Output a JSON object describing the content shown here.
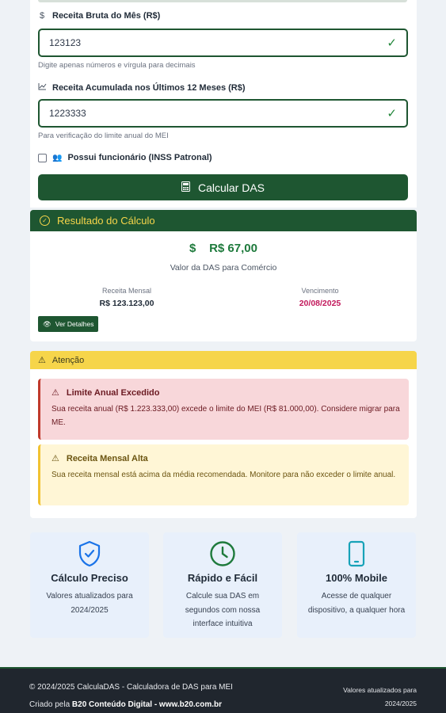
{
  "form": {
    "revenue_label": "Receita Bruta do Mês (R$)",
    "revenue_value": "123123",
    "revenue_hint": "Digite apenas números e vírgula para decimais",
    "accumulated_label": "Receita Acumulada nos Últimos 12 Meses (R$)",
    "accumulated_value": "1223333",
    "accumulated_hint": "Para verificação do limite anual do MEI",
    "employee_label": "Possui funcionário (INSS Patronal)",
    "employee_checked": false,
    "calculate_label": "Calcular DAS",
    "icons": {
      "revenue": "dollar-icon",
      "accumulated": "chart-line-icon",
      "employee": "people-icon",
      "calculate": "calculator-icon",
      "valid": "check-icon"
    }
  },
  "result": {
    "header": "Resultado do Cálculo",
    "currency_symbol": "$",
    "amount": "R$ 67,00",
    "amount_label": "Valor da DAS para Comércio",
    "monthly_label": "Receita Mensal",
    "monthly_value": "R$ 123.123,00",
    "due_label": "Vencimento",
    "due_value": "20/08/2025",
    "details_button": "Ver Detalhes"
  },
  "attention": {
    "header": "Atenção",
    "alerts": [
      {
        "type": "danger",
        "title": "Limite Anual Excedido",
        "body": "Sua receita anual (R$ 1.223.333,00) excede o limite do MEI (R$ 81.000,00). Considere migrar para ME."
      },
      {
        "type": "warning",
        "title": "Receita Mensal Alta",
        "body": "Sua receita mensal está acima da média recomendada. Monitore para não exceder o limite anual."
      }
    ]
  },
  "features": [
    {
      "icon": "shield-check-icon",
      "title": "Cálculo Preciso",
      "description": "Valores atualizados para 2024/2025"
    },
    {
      "icon": "clock-icon",
      "title": "Rápido e Fácil",
      "description": "Calcule sua DAS em segundos com nossa interface intuitiva"
    },
    {
      "icon": "mobile-icon",
      "title": "100% Mobile",
      "description": "Acesse de qualquer dispositivo, a qualquer hora"
    }
  ],
  "footer": {
    "copyright": "© 2024/2025 CalculaDAS - Calculadora de DAS para MEI",
    "created_prefix": "Criado pela ",
    "created_by": "B20 Conteúdo Digital - www.b20.com.br",
    "updated_note": "Valores atualizados para 2024/2025"
  },
  "colors": {
    "primary": "#1e5631",
    "accent": "#f6d54a",
    "danger": "#c0392b",
    "warning": "#f1c232",
    "success": "#1e7a3c"
  }
}
